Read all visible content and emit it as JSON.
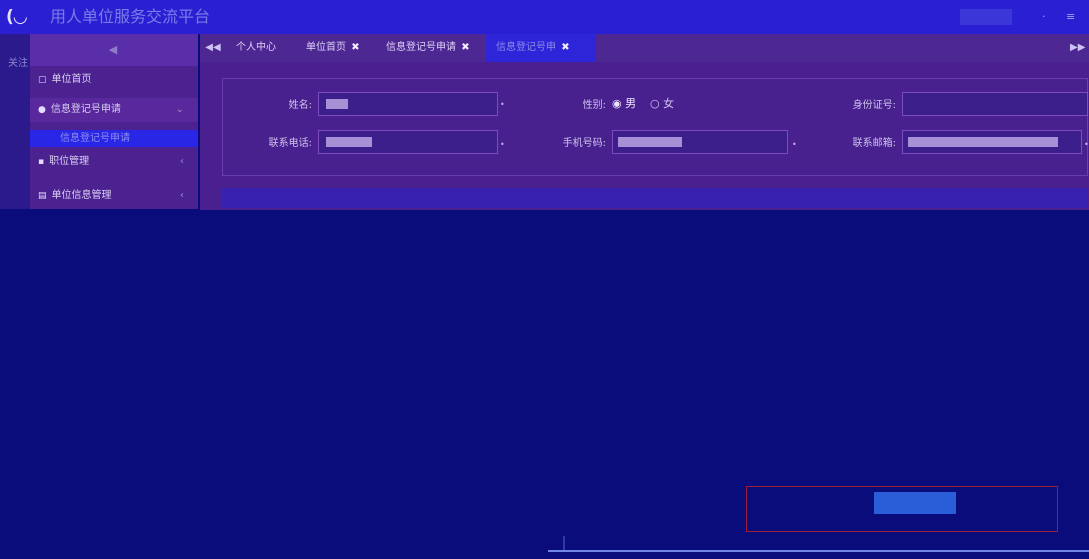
{
  "header": {
    "logo_text": "(◡",
    "title": "用人单位服务交流平台",
    "dot_icon": "·",
    "menu_icon": "≡"
  },
  "left_strip": {
    "text": "关注"
  },
  "sidebar": {
    "items": [
      {
        "label": "单位首页",
        "icon": "square-icon"
      },
      {
        "label": "信息登记号申请",
        "icon": "users-icon"
      },
      {
        "label": "信息登记号申请",
        "icon": "none"
      },
      {
        "label": "职位管理",
        "icon": "list-icon"
      },
      {
        "label": "单位信息管理",
        "icon": "doc-icon"
      }
    ]
  },
  "tabs": [
    {
      "label": "个人中心"
    },
    {
      "label": "单位首页"
    },
    {
      "label": "信息登记号申请"
    },
    {
      "label": "信息登记号申"
    }
  ],
  "form": {
    "name_label": "姓名:",
    "gender_label": "性别:",
    "gender_male": "男",
    "gender_female": "女",
    "gender_selected": "男",
    "id_label": "身份证号:",
    "tel_label": "联系电话:",
    "mobile_label": "手机号码:",
    "email_label": "联系邮箱:"
  },
  "colors": {
    "background": "#0a0c7c",
    "header": "#2a1fd2",
    "sidebar": "#4b2290",
    "notice_red": "#d9161c"
  }
}
